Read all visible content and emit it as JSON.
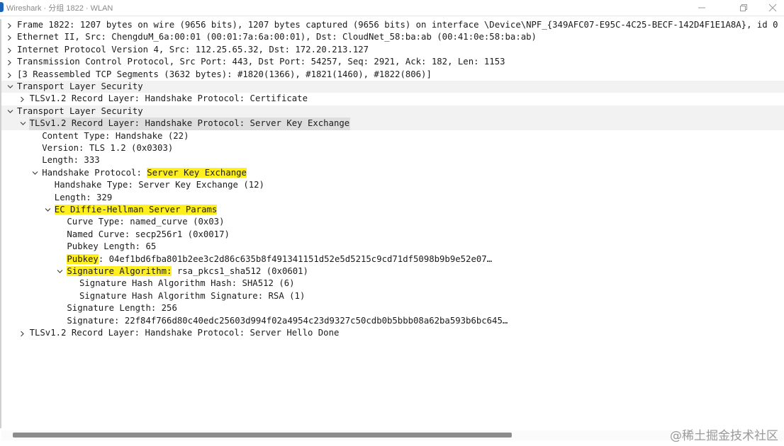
{
  "window": {
    "title": "Wireshark · 分组 1822 · WLAN"
  },
  "packet_details": {
    "rows": [
      {
        "text": "Frame 1822: 1207 bytes on wire (9656 bits), 1207 bytes captured (9656 bits) on interface \\Device\\NPF_{349AFC07-E95C-4C25-BECF-142D4F1E1A8A}, id 0",
        "state": "collapsed"
      },
      {
        "text": "Ethernet II, Src: ChengduM_6a:00:01 (00:01:7a:6a:00:01), Dst: CloudNet_58:ba:ab (00:41:0e:58:ba:ab)",
        "state": "collapsed"
      },
      {
        "text": "Internet Protocol Version 4, Src: 112.25.65.32, Dst: 172.20.213.127",
        "state": "collapsed"
      },
      {
        "text": "Transmission Control Protocol, Src Port: 443, Dst Port: 54257, Seq: 2921, Ack: 182, Len: 1153",
        "state": "collapsed"
      },
      {
        "text": "[3 Reassembled TCP Segments (3632 bytes): #1820(1366), #1821(1460), #1822(806)]",
        "state": "collapsed"
      },
      {
        "text": "Transport Layer Security",
        "state": "expanded"
      },
      {
        "text": "TLSv1.2 Record Layer: Handshake Protocol: Certificate",
        "state": "collapsed"
      },
      {
        "text": "Transport Layer Security",
        "state": "expanded"
      },
      {
        "text": "TLSv1.2 Record Layer: Handshake Protocol: Server Key Exchange",
        "state": "expanded"
      },
      {
        "text": "Content Type: Handshake (22)",
        "state": "leaf"
      },
      {
        "text": "Version: TLS 1.2 (0x0303)",
        "state": "leaf"
      },
      {
        "text": "Length: 333",
        "state": "leaf"
      },
      {
        "text_pre": "Handshake Protocol: ",
        "text_hl": "Server Key Exchange",
        "text_post": "",
        "state": "expanded"
      },
      {
        "text": "Handshake Type: Server Key Exchange (12)",
        "state": "leaf"
      },
      {
        "text": "Length: 329",
        "state": "leaf"
      },
      {
        "text_pre": "",
        "text_hl": "EC Diffie-Hellman Server Params",
        "text_post": "",
        "state": "expanded"
      },
      {
        "text": "Curve Type: named_curve (0x03)",
        "state": "leaf"
      },
      {
        "text": "Named Curve: secp256r1 (0x0017)",
        "state": "leaf"
      },
      {
        "text": "Pubkey Length: 65",
        "state": "leaf"
      },
      {
        "text_pre": "",
        "text_hl": "Pubkey",
        "text_post": ": 04ef1bd6fba801b2ee3c2d86c635b8f491341151d52e5d5215c9cd71df5098b9b9e52e07…",
        "state": "leaf"
      },
      {
        "text_pre": "",
        "text_hl": "Signature Algorithm:",
        "text_post": " rsa_pkcs1_sha512 (0x0601)",
        "state": "expanded"
      },
      {
        "text": "Signature Hash Algorithm Hash: SHA512 (6)",
        "state": "leaf"
      },
      {
        "text": "Signature Hash Algorithm Signature: RSA (1)",
        "state": "leaf"
      },
      {
        "text": "Signature Length: 256",
        "state": "leaf"
      },
      {
        "text": "Signature: 22f84f766d80c40edc25603d994f02a4954c23d9327c50cdb0b5bbb08a62ba593b6bc645…",
        "state": "leaf"
      },
      {
        "text": "TLSv1.2 Record Layer: Handshake Protocol: Server Hello Done",
        "state": "collapsed"
      }
    ]
  },
  "watermark": "@稀土掘金技术社区",
  "colors": {
    "highlight": "#ffef1f",
    "selected_row": "#dedede",
    "alt_row": "#f2f2f2"
  }
}
